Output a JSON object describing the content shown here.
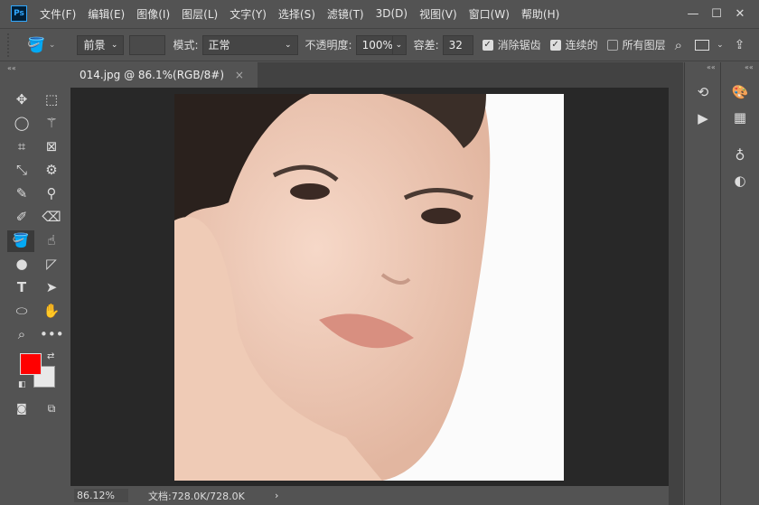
{
  "app": {
    "logo": "Ps"
  },
  "menu": [
    "文件(F)",
    "编辑(E)",
    "图像(I)",
    "图层(L)",
    "文字(Y)",
    "选择(S)",
    "滤镜(T)",
    "3D(D)",
    "视图(V)",
    "窗口(W)",
    "帮助(H)"
  ],
  "window_controls": [
    "—",
    "☐",
    "✕"
  ],
  "options": {
    "fill_source": "前景",
    "mode_label": "模式:",
    "mode_value": "正常",
    "opacity_label": "不透明度:",
    "opacity_value": "100%",
    "tolerance_label": "容差:",
    "tolerance_value": "32",
    "antialias": {
      "label": "消除锯齿",
      "checked": true
    },
    "contiguous": {
      "label": "连续的",
      "checked": true
    },
    "all_layers": {
      "label": "所有图层",
      "checked": false
    }
  },
  "document": {
    "tab_title": "014.jpg @ 86.1%(RGB/8#)",
    "close": "×"
  },
  "status": {
    "zoom": "86.12%",
    "doc_info": "文档:728.0K/728.0K",
    "arrow": "›"
  },
  "colors": {
    "foreground": "#ff0000",
    "background": "#e8e8e8"
  }
}
